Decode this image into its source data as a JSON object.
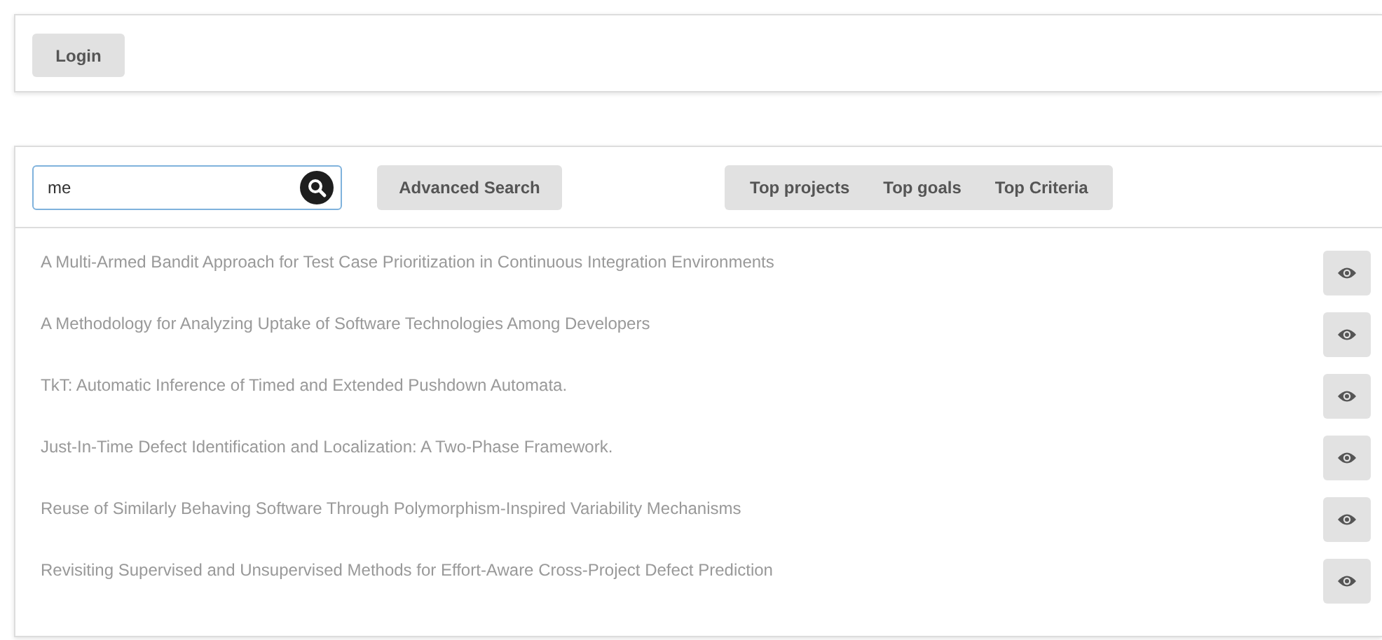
{
  "header": {
    "login_button": "Login"
  },
  "search": {
    "value": "me",
    "advanced_button": "Advanced Search"
  },
  "tabs": [
    {
      "label": "Top projects"
    },
    {
      "label": "Top goals"
    },
    {
      "label": "Top Criteria"
    }
  ],
  "results": [
    {
      "title": "A Multi-Armed Bandit Approach for Test Case Prioritization in Continuous Integration Environments"
    },
    {
      "title": "A Methodology for Analyzing Uptake of Software Technologies Among Developers"
    },
    {
      "title": "TkT: Automatic Inference of Timed and Extended Pushdown Automata."
    },
    {
      "title": "Just-In-Time Defect Identification and Localization: A Two-Phase Framework."
    },
    {
      "title": "Reuse of Similarly Behaving Software Through Polymorphism-Inspired Variability Mechanisms"
    },
    {
      "title": "Revisiting Supervised and Unsupervised Methods for Effort-Aware Cross-Project Defect Prediction"
    }
  ]
}
